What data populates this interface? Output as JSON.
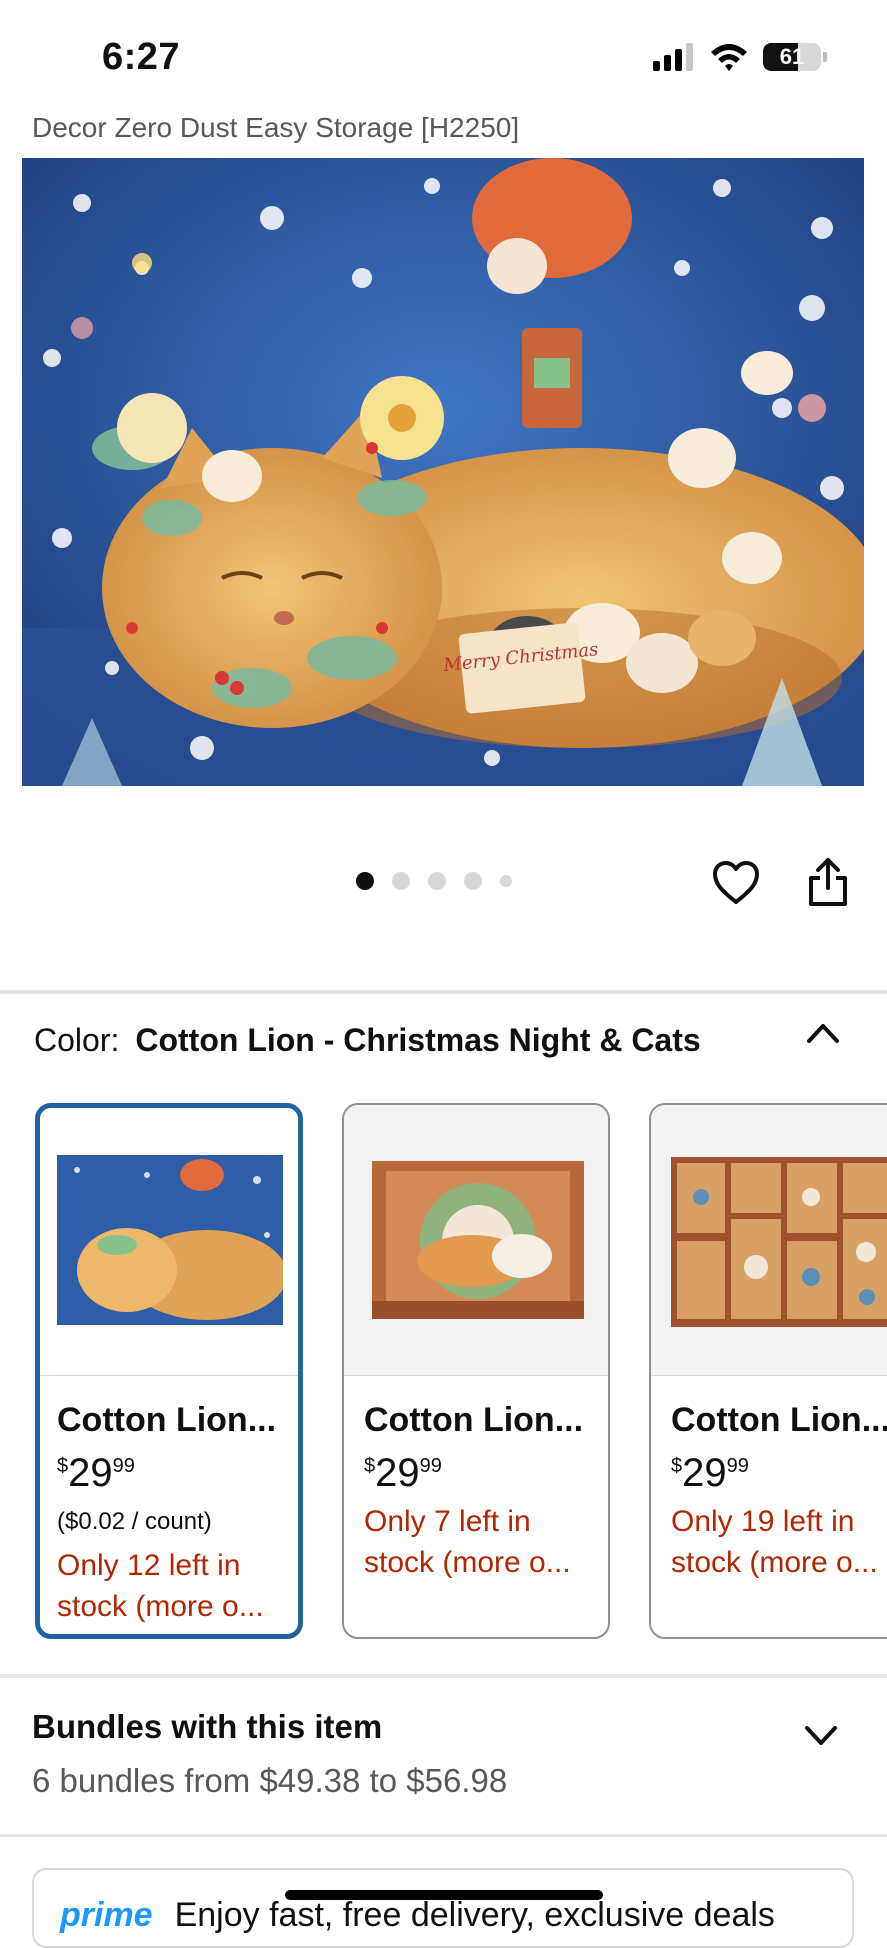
{
  "status_bar": {
    "time": "6:27",
    "battery": "61",
    "battery_level": 0.61
  },
  "product": {
    "title": "Decor Zero Dust Easy Storage [H2250]"
  },
  "hero_image": {
    "alt": "Cotton Lion - Christmas Night & Cats puzzle artwork",
    "card_text": "Merry Christmas"
  },
  "carousel": {
    "total": 5,
    "active": 0
  },
  "color_selector": {
    "label": "Color:",
    "value": "Cotton Lion - Christmas Night & Cats",
    "options": [
      {
        "name": "Cotton Lion...",
        "currency": "$",
        "price_whole": "29",
        "price_fraction": "99",
        "unit_price": "($0.02 / count)",
        "stock_line1": "Only 12 left in",
        "stock_line2": "stock (more o...",
        "selected": true
      },
      {
        "name": "Cotton Lion...",
        "currency": "$",
        "price_whole": "29",
        "price_fraction": "99",
        "unit_price": "",
        "stock_line1": "Only 7 left in",
        "stock_line2": "stock (more o...",
        "selected": false
      },
      {
        "name": "Cotton Lion...",
        "currency": "$",
        "price_whole": "29",
        "price_fraction": "99",
        "unit_price": "",
        "stock_line1": "Only 19 left in",
        "stock_line2": "stock (more o...",
        "selected": false
      }
    ]
  },
  "bundles": {
    "title": "Bundles with this item",
    "subtitle": "6 bundles from $49.38 to $56.98"
  },
  "prime": {
    "logo": "prime",
    "text": "Enjoy fast, free delivery, exclusive deals"
  },
  "colors": {
    "accent_selected": "#2162a1",
    "stock_red": "#b12704",
    "prime_blue": "#1a98ff"
  }
}
